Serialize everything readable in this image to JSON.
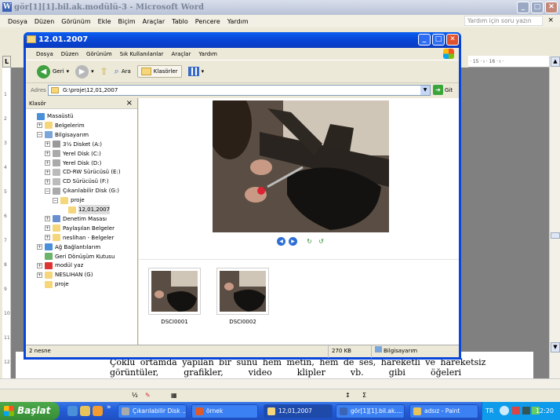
{
  "word": {
    "title": "gör[1][1].bil.ak.modülü-3 - Microsoft Word",
    "menu": [
      "Dosya",
      "Düzen",
      "Görünüm",
      "Ekle",
      "Biçim",
      "Araçlar",
      "Tablo",
      "Pencere",
      "Yardım"
    ],
    "help_placeholder": "Yardım için soru yazın",
    "ruler_text": "· 15 · ı · 16 · ı ·",
    "doc_line1": "Çoklu ortamda yapılan bir sunu   hem metin, hem de ses, hareketli ve hareketsiz",
    "doc_line2": [
      "görüntüler,",
      "grafikler,",
      "video",
      "klipler",
      "vb.",
      "gibi",
      "öğeleri"
    ],
    "zoom": "½"
  },
  "explorer": {
    "title": "12.01.2007",
    "menu": [
      "Dosya",
      "Düzen",
      "Görünüm",
      "Sık Kullanılanlar",
      "Araçlar",
      "Yardım"
    ],
    "toolbar": {
      "back": "Geri",
      "search": "Ara",
      "folders": "Klasörler"
    },
    "address_label": "Adres",
    "address": "G:\\proje\\12,01,2007",
    "go": "Git",
    "folders_title": "Klasör",
    "tree": [
      {
        "label": "Masaüstü",
        "indent": 0,
        "pm": "",
        "icon": "#4a90d9"
      },
      {
        "label": "Belgelerim",
        "indent": 1,
        "pm": "+",
        "icon": "#f5d67a"
      },
      {
        "label": "Bilgisayarım",
        "indent": 1,
        "pm": "−",
        "icon": "#7aa6d9"
      },
      {
        "label": "3½ Disket (A:)",
        "indent": 2,
        "pm": "+",
        "icon": "#999"
      },
      {
        "label": "Yerel Disk (C:)",
        "indent": 2,
        "pm": "+",
        "icon": "#aaa"
      },
      {
        "label": "Yerel Disk (D:)",
        "indent": 2,
        "pm": "+",
        "icon": "#aaa"
      },
      {
        "label": "CD-RW Sürücüsü (E:)",
        "indent": 2,
        "pm": "+",
        "icon": "#bbb"
      },
      {
        "label": "CD Sürücüsü (F:)",
        "indent": 2,
        "pm": "+",
        "icon": "#bbb"
      },
      {
        "label": "Çıkarılabilir Disk (G:)",
        "indent": 2,
        "pm": "−",
        "icon": "#aaa"
      },
      {
        "label": "proje",
        "indent": 3,
        "pm": "−",
        "icon": "#f5d67a"
      },
      {
        "label": "12,01,2007",
        "indent": 4,
        "pm": "",
        "icon": "#f5d67a",
        "selected": true
      },
      {
        "label": "Denetim Masası",
        "indent": 2,
        "pm": "+",
        "icon": "#6a8fd0"
      },
      {
        "label": "Paylaşılan Belgeler",
        "indent": 2,
        "pm": "+",
        "icon": "#f5d67a"
      },
      {
        "label": "neslihan - Belgeler",
        "indent": 2,
        "pm": "+",
        "icon": "#f5d67a"
      },
      {
        "label": "Ağ Bağlantılarım",
        "indent": 1,
        "pm": "+",
        "icon": "#4a90d9"
      },
      {
        "label": "Geri Dönüşüm Kutusu",
        "indent": 1,
        "pm": "",
        "icon": "#6bb36b"
      },
      {
        "label": "modül yaz",
        "indent": 1,
        "pm": "+",
        "icon": "#d33"
      },
      {
        "label": "NESLIHAN (G)",
        "indent": 1,
        "pm": "+",
        "icon": "#f5d67a"
      },
      {
        "label": "proje",
        "indent": 1,
        "pm": "",
        "icon": "#f5d67a"
      }
    ],
    "thumbnails": [
      "DSCI0001",
      "DSCI0002"
    ],
    "status": {
      "count": "2 nesne",
      "size": "270 KB",
      "location": "Bilgisayarım"
    }
  },
  "taskbar": {
    "start": "Başlat",
    "tasks": [
      {
        "label": "Çıkarılabilir Disk ...",
        "icon": "#aaa"
      },
      {
        "label": "örnek",
        "icon": "#e05a2a"
      },
      {
        "label": "12,01,2007",
        "icon": "#f5d67a",
        "active": true
      },
      {
        "label": "gör[1][1].bil.ak....",
        "icon": "#3c64b4"
      },
      {
        "label": "adsız - Paint",
        "icon": "#e8c35a"
      }
    ],
    "lang": "TR",
    "clock": "12:20"
  }
}
